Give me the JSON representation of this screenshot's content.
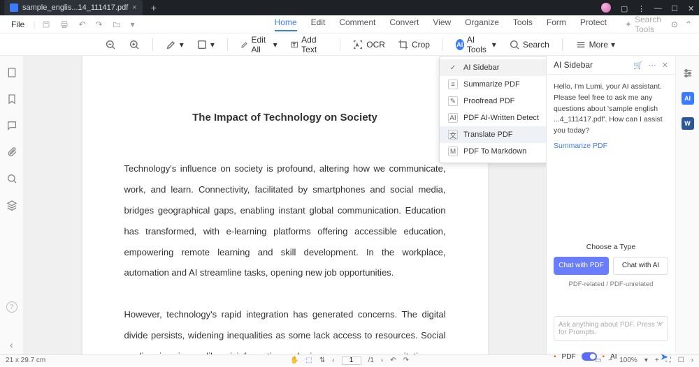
{
  "titlebar": {
    "tab_name": "sample_englis...14_111417.pdf"
  },
  "menubar": {
    "file": "File",
    "tabs": [
      "Home",
      "Edit",
      "Comment",
      "Convert",
      "View",
      "Organize",
      "Tools",
      "Form",
      "Protect"
    ],
    "active_tab": "Home",
    "search_tools_placeholder": "Search Tools"
  },
  "toolbar": {
    "edit_all": "Edit All",
    "add_text": "Add Text",
    "ocr": "OCR",
    "crop": "Crop",
    "ai_tools": "AI Tools",
    "search": "Search",
    "more": "More"
  },
  "ai_dropdown": {
    "items": [
      {
        "label": "AI Sidebar",
        "selected": true
      },
      {
        "label": "Summarize PDF"
      },
      {
        "label": "Proofread PDF"
      },
      {
        "label": "PDF AI-Written Detect"
      },
      {
        "label": "Translate PDF",
        "hover": true
      },
      {
        "label": "PDF To Markdown"
      }
    ]
  },
  "document": {
    "title": "The Impact of Technology on Society",
    "para1": "Technology's influence on society is profound, altering how we communicate, work, and learn. Connectivity, facilitated by smartphones and social media, bridges geographical gaps, enabling instant global communication. Education has transformed, with e-learning platforms offering accessible education, empowering remote learning and skill development. In the workplace, automation and AI streamline tasks, opening new job opportunities.",
    "para2": "However, technology's rapid integration has generated concerns. The digital divide persists, widening inequalities as some lack access to resources. Social media raises issues like misinformation and privacy concerns, necessitating"
  },
  "ai_sidebar": {
    "title": "AI Sidebar",
    "greeting": "Hello, I'm Lumi, your AI assistant. Please feel free to ask me any questions about 'sample english ...4_111417.pdf'. How can I assist you today?",
    "summarize_link": "Summarize PDF",
    "choose_label": "Choose a Type",
    "chat_with_pdf": "Chat with PDF",
    "chat_with_ai": "Chat with AI",
    "subtext": "PDF-related / PDF-unrelated",
    "input_placeholder": "Ask anything about PDF. Press '#' for Prompts.",
    "footer_pdf": "PDF",
    "footer_ai": "AI"
  },
  "statusbar": {
    "dimensions": "21 x 29.7 cm",
    "page_current": "1",
    "page_total": "/1",
    "zoom": "100%"
  }
}
